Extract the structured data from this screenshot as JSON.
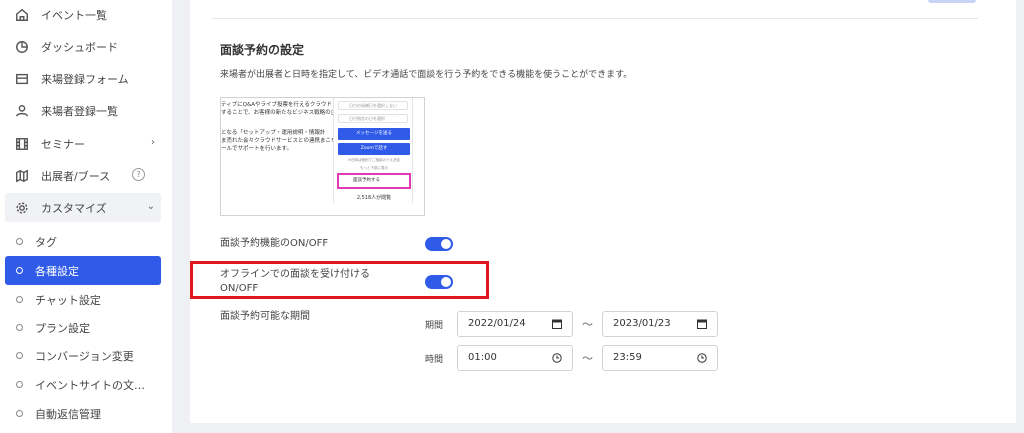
{
  "sidebar": {
    "items": [
      {
        "label": "イベント一覧"
      },
      {
        "label": "ダッシュボード"
      },
      {
        "label": "来場登録フォーム"
      },
      {
        "label": "来場者登録一覧"
      },
      {
        "label": "セミナー"
      },
      {
        "label": "出展者/ブース"
      },
      {
        "label": "カスタマイズ"
      }
    ],
    "sub_items": [
      {
        "label": "タグ"
      },
      {
        "label": "各種設定"
      },
      {
        "label": "チャット設定"
      },
      {
        "label": "プラン設定"
      },
      {
        "label": "コンバージョン変更"
      },
      {
        "label": "イベントサイトの文…"
      },
      {
        "label": "自動返信管理"
      }
    ],
    "help_glyph": "?",
    "chevron_right": "›",
    "chevron_down": "⌄"
  },
  "section": {
    "title": "面談予約の設定",
    "description": "来場者が出展者と日時を指定して、ビデオ通話で面談を行う予約をできる機能を使うことができます。"
  },
  "preview": {
    "left_lines": [
      "ティブにQ&Aやライブ投票を行えるクラウド",
      "することで、お客様の新たなビジネス戦略の企",
      "となる「セットアップ・運用説明・情報計",
      "ま売れた会々クラウドサービスとの連携まこを",
      "ールでサポートを行います。"
    ],
    "radio1": "日付の候補日を選択しない",
    "radio2": "日付指定の日を選択",
    "message_btn": "メッセージを送る",
    "zoom_btn": "Zoomで話す",
    "small1": "※日時は個別でご相談のうえ決定",
    "small2": "もっと下部に表示",
    "reserve_btn": "面談予約する",
    "count": "2,518人が閲覧"
  },
  "settings": {
    "feature_label": "面談予約機能のON/OFF",
    "offline_label_line1": "オフラインでの面談を受け付ける",
    "offline_label_line2": "ON/OFF",
    "period_label": "面談予約可能な期間",
    "date_label": "期間",
    "time_label": "時間",
    "start_date": "2022/01/24",
    "end_date": "2023/01/23",
    "start_time": "01:00",
    "end_time": "23:59",
    "tilde": "～"
  },
  "colors": {
    "accent": "#2f5be8",
    "highlight": "#e0171d",
    "preview_highlight": "#e23ab6"
  }
}
